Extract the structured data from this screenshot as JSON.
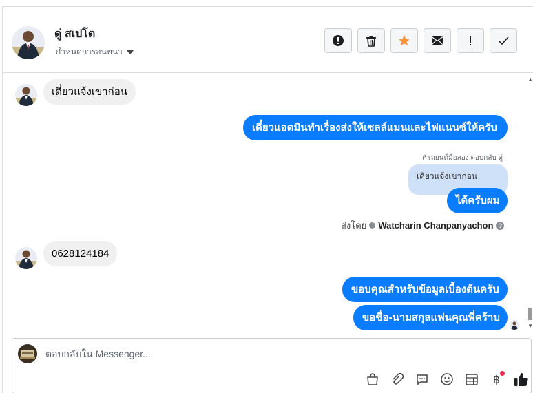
{
  "header": {
    "contact_name": "ดู่ สเปโต",
    "settings_label": "กำหนดการสนทนา",
    "toolbar": [
      {
        "name": "spam-button",
        "icon": "exclamation-circle-icon"
      },
      {
        "name": "delete-button",
        "icon": "trash-icon"
      },
      {
        "name": "star-button",
        "icon": "star-icon",
        "color": "#f7923a"
      },
      {
        "name": "mark-unread-button",
        "icon": "envelope-icon"
      },
      {
        "name": "follow-up-button",
        "icon": "exclamation-icon"
      },
      {
        "name": "done-button",
        "icon": "check-icon"
      }
    ]
  },
  "messages": {
    "m1": "เดี๋ยวแจ้งเขาก่อน",
    "m2": "เดี๋ยวแอดมินทำเรื่องส่งให้เซลล์แมนและไฟแนนซ์ให้ครับ",
    "reply_note": "รถยนต์มือสอง ตอบกลับ ดู่",
    "quoted": "เดี๋ยวแจ้งเขาก่อน",
    "m3": "ได้ครับผม",
    "sent_by_prefix": "ส่งโดย",
    "sent_by_name": "Watcharin Chanpanyachon",
    "m4": "0628124184",
    "m5": "ขอบคุณสำหรับข้อมูลเบื้องต้นครับ",
    "m6": "ขอชื่อ-นามสกุลแฟนคุณพี่คร้าบ"
  },
  "composer": {
    "placeholder": "ตอบกลับใน Messenger..."
  },
  "colors": {
    "outgoing": "#0a7cff",
    "incoming": "#f0f0f0",
    "quote": "#cfe1f8",
    "star": "#f7923a"
  }
}
